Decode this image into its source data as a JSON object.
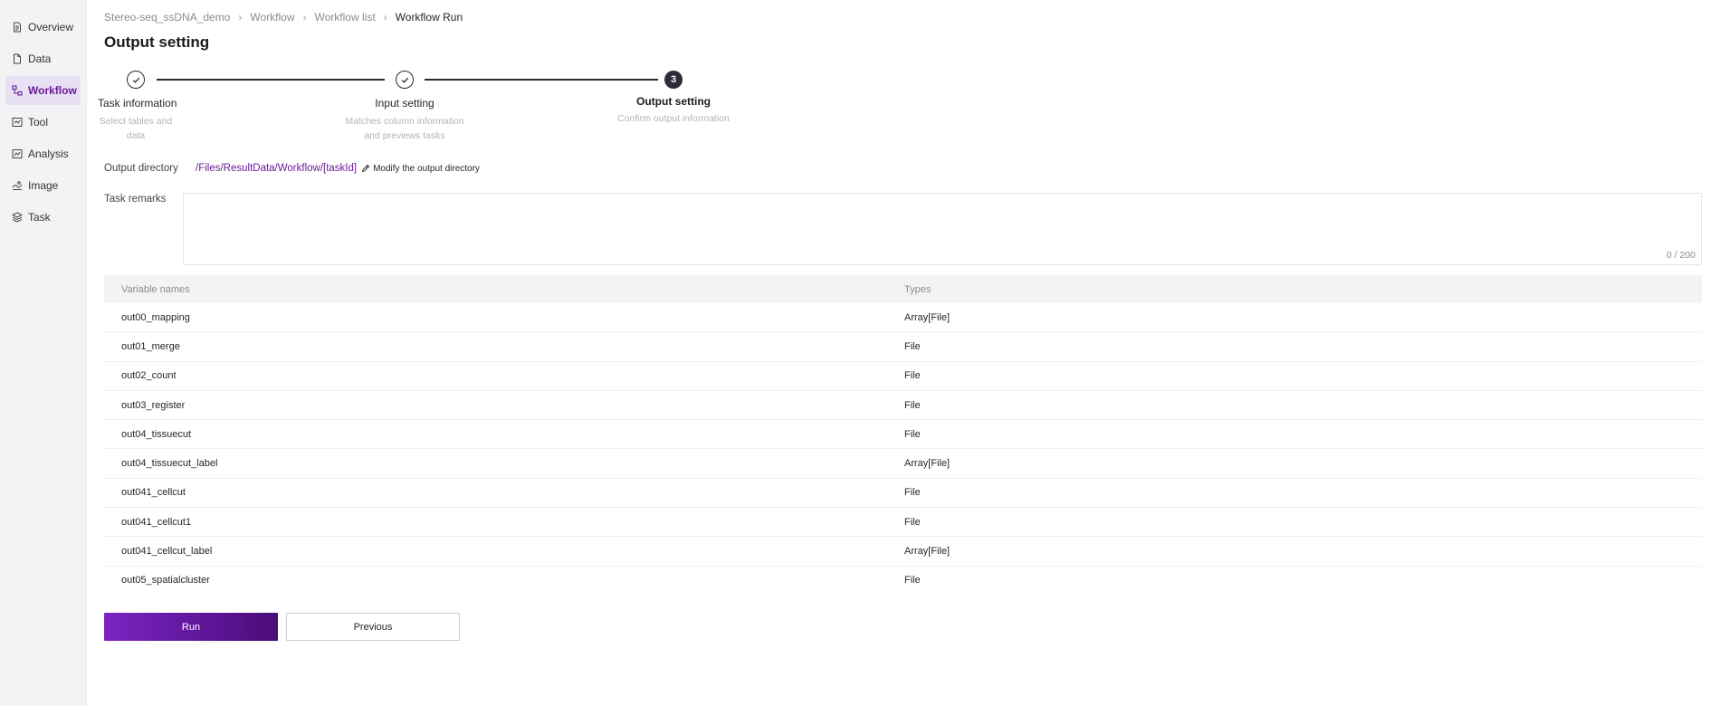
{
  "sidebar": {
    "items": [
      {
        "label": "Overview",
        "icon": "document-icon"
      },
      {
        "label": "Data",
        "icon": "file-icon"
      },
      {
        "label": "Workflow",
        "icon": "workflow-icon",
        "active": true
      },
      {
        "label": "Tool",
        "icon": "tool-icon"
      },
      {
        "label": "Analysis",
        "icon": "analysis-icon"
      },
      {
        "label": "Image",
        "icon": "image-icon"
      },
      {
        "label": "Task",
        "icon": "layers-icon"
      }
    ]
  },
  "breadcrumb": [
    "Stereo-seq_ssDNA_demo",
    "Workflow",
    "Workflow list",
    "Workflow Run"
  ],
  "page": {
    "title": "Output setting"
  },
  "steps": [
    {
      "title": "Task information",
      "desc": "Select tables and data",
      "status": "done"
    },
    {
      "title": "Input setting",
      "desc1": "Matches column information",
      "desc2": "and previews tasks",
      "status": "done"
    },
    {
      "title": "Output setting",
      "desc": "Confirm output information",
      "status": "current",
      "number": "3"
    }
  ],
  "output": {
    "label": "Output directory",
    "path": "/Files/ResultData/Workflow/[taskId]",
    "modify_label": "Modify the output directory"
  },
  "remarks": {
    "label": "Task remarks",
    "value": "",
    "count": "0 / 200"
  },
  "table": {
    "headers": {
      "name": "Variable names",
      "type": "Types"
    },
    "rows": [
      {
        "name": "out00_mapping",
        "type": "Array[File]"
      },
      {
        "name": "out01_merge",
        "type": "File"
      },
      {
        "name": "out02_count",
        "type": "File"
      },
      {
        "name": "out03_register",
        "type": "File"
      },
      {
        "name": "out04_tissuecut",
        "type": "File"
      },
      {
        "name": "out04_tissuecut_label",
        "type": "Array[File]"
      },
      {
        "name": "out041_cellcut",
        "type": "File"
      },
      {
        "name": "out041_cellcut1",
        "type": "File"
      },
      {
        "name": "out041_cellcut_label",
        "type": "Array[File]"
      },
      {
        "name": "out05_spatialcluster",
        "type": "File"
      }
    ]
  },
  "buttons": {
    "run": "Run",
    "previous": "Previous"
  },
  "colors": {
    "accent": "#6a1b9a",
    "run_start": "#7b24c4",
    "run_end": "#4a0c78"
  }
}
